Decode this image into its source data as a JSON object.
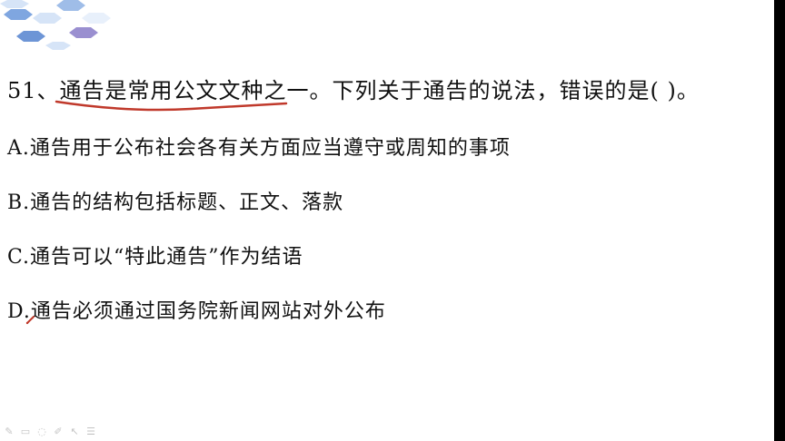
{
  "question": {
    "text": "51、通告是常用公文文种之一。下列关于通告的说法，错误的是( )。"
  },
  "options": [
    {
      "text": "A.通告用于公布社会各有关方面应当遵守或周知的事项"
    },
    {
      "text": "B.通告的结构包括标题、正文、落款"
    },
    {
      "text": "C.通告可以“特此通告”作为结语"
    },
    {
      "text": "D.通告必须通过国务院新闻网站对外公布"
    }
  ],
  "annotation": {
    "underline_color": "#c0392b"
  },
  "toolbar": {
    "icons": [
      "pen-icon",
      "rectangle-icon",
      "eraser-icon",
      "highlighter-icon",
      "pointer-icon",
      "menu-icon"
    ]
  },
  "colors": {
    "hex_blue": "#7fa6e0",
    "hex_light": "#d6e4f7",
    "hex_purple": "#9a8fd0",
    "text": "#111111",
    "background": "#ffffff"
  }
}
